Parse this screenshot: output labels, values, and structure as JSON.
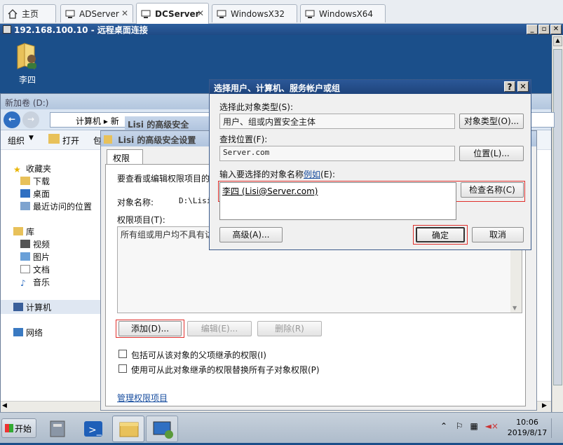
{
  "browser_tabs": [
    {
      "label": "主页",
      "icon": "home-icon"
    },
    {
      "label": "ADServer",
      "icon": "monitor-icon"
    },
    {
      "label": "DCServer",
      "icon": "monitor-icon"
    },
    {
      "label": "WindowsX32",
      "icon": "monitor-icon"
    },
    {
      "label": "WindowsX64",
      "icon": "monitor-icon"
    }
  ],
  "tab_close": "✕",
  "rdp": {
    "title": "192.168.100.10 - 远程桌面连接",
    "btn_min": "_",
    "btn_restore": "▫",
    "btn_close": "✕"
  },
  "desktop": {
    "icon_label": "李四"
  },
  "explorer": {
    "title": "新加卷 (D:)",
    "address": [
      "计算机",
      "新"
    ],
    "toolbar": {
      "organize": "组织",
      "open": "打开",
      "more": "包"
    },
    "nav": {
      "favorites": "收藏夹",
      "downloads": "下载",
      "desktop": "桌面",
      "recent": "最近访问的位置",
      "libraries": "库",
      "videos": "视频",
      "pictures": "图片",
      "documents": "文档",
      "music": "音乐",
      "computer": "计算机",
      "network": "网络"
    }
  },
  "security_dialog": {
    "title_bg": "Lisi 的高级安全",
    "title": "Lisi 的高级安全设置",
    "tab": "权限",
    "intro": "要查看或编辑权限项目的",
    "object_label": "对象名称:",
    "object_value": "D:\\Lisi",
    "entries_label": "权限项目(T):",
    "entries_text": "所有组或用户均不具有访",
    "add": "添加(D)...",
    "edit": "编辑(E)...",
    "remove": "删除(R)",
    "inherit": "包括可从该对象的父项继承的权限(I)",
    "replace": "使用可从此对象继承的权限替换所有子对象权限(P)",
    "manage_link": "管理权限项目"
  },
  "select_dialog": {
    "title": "选择用户、计算机、服务帐户或组",
    "help": "?",
    "close": "✕",
    "type_label": "选择此对象类型(S):",
    "type_value": "用户、组或内置安全主体",
    "type_button": "对象类型(O)...",
    "location_label": "查找位置(F):",
    "location_value": "Server.com",
    "location_button": "位置(L)...",
    "names_label": "输入要选择的对象名称",
    "names_example": "例如",
    "names_label_tail": "(E):",
    "names_value": "李四 (Lisi@Server.com)",
    "check_names": "检查名称(C)",
    "advanced": "高级(A)...",
    "ok": "确定",
    "cancel": "取消"
  },
  "taskbar": {
    "start": "开始",
    "time": "10:06",
    "date": "2019/8/17"
  }
}
